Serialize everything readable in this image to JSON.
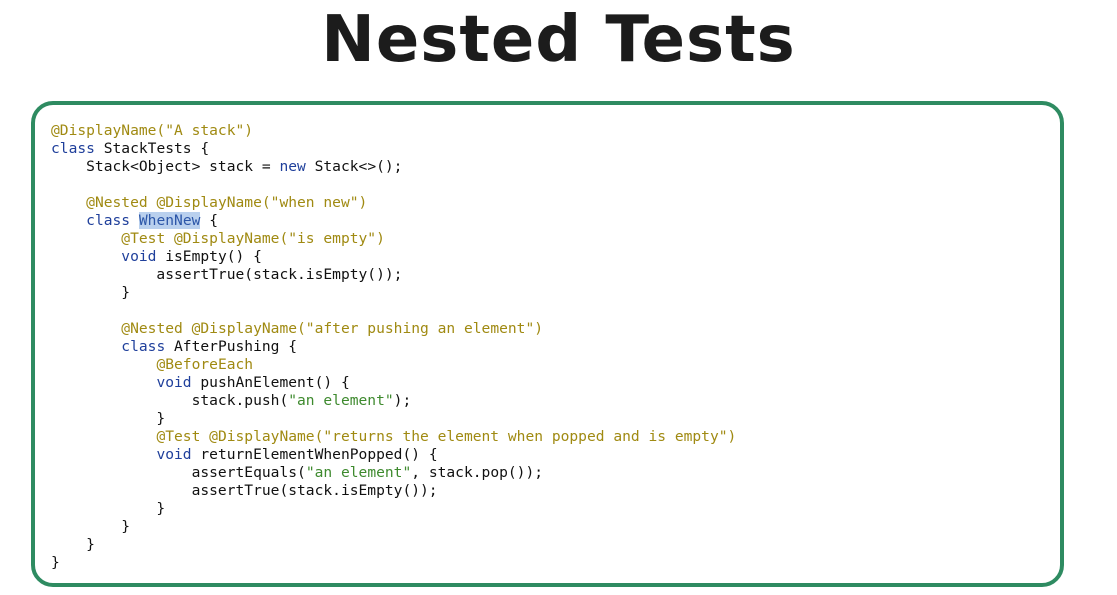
{
  "slide": {
    "title": "Nested Tests"
  },
  "code": {
    "lines": [
      [
        {
          "text": "@DisplayName(\"A stack\")",
          "kind": "annotation"
        }
      ],
      [
        {
          "text": "class",
          "kind": "keyword"
        },
        {
          "text": " StackTests {",
          "kind": "plain"
        }
      ],
      [
        {
          "text": "    Stack<Object> stack = ",
          "kind": "plain"
        },
        {
          "text": "new",
          "kind": "keyword"
        },
        {
          "text": " Stack<>();",
          "kind": "plain"
        }
      ],
      [],
      [
        {
          "text": "    ",
          "kind": "plain"
        },
        {
          "text": "@Nested @DisplayName(\"when new\")",
          "kind": "annotation"
        }
      ],
      [
        {
          "text": "    ",
          "kind": "plain"
        },
        {
          "text": "class",
          "kind": "keyword"
        },
        {
          "text": " ",
          "kind": "plain"
        },
        {
          "text": "WhenNew",
          "kind": "selected"
        },
        {
          "text": " {",
          "kind": "plain"
        }
      ],
      [
        {
          "text": "        ",
          "kind": "plain"
        },
        {
          "text": "@Test @DisplayName(\"is empty\")",
          "kind": "annotation"
        }
      ],
      [
        {
          "text": "        ",
          "kind": "plain"
        },
        {
          "text": "void",
          "kind": "keyword"
        },
        {
          "text": " isEmpty() {",
          "kind": "plain"
        }
      ],
      [
        {
          "text": "            assertTrue(stack.isEmpty());",
          "kind": "plain"
        }
      ],
      [
        {
          "text": "        }",
          "kind": "plain"
        }
      ],
      [],
      [
        {
          "text": "        ",
          "kind": "plain"
        },
        {
          "text": "@Nested @DisplayName(\"after pushing an element\")",
          "kind": "annotation"
        }
      ],
      [
        {
          "text": "        ",
          "kind": "plain"
        },
        {
          "text": "class",
          "kind": "keyword"
        },
        {
          "text": " AfterPushing {",
          "kind": "plain"
        }
      ],
      [
        {
          "text": "            ",
          "kind": "plain"
        },
        {
          "text": "@BeforeEach",
          "kind": "annotation"
        }
      ],
      [
        {
          "text": "            ",
          "kind": "plain"
        },
        {
          "text": "void",
          "kind": "keyword"
        },
        {
          "text": " pushAnElement() {",
          "kind": "plain"
        }
      ],
      [
        {
          "text": "                stack.push(",
          "kind": "plain"
        },
        {
          "text": "\"an element\"",
          "kind": "string"
        },
        {
          "text": ");",
          "kind": "plain"
        }
      ],
      [
        {
          "text": "            }",
          "kind": "plain"
        }
      ],
      [
        {
          "text": "            ",
          "kind": "plain"
        },
        {
          "text": "@Test @DisplayName(\"returns the element when popped and is empty\")",
          "kind": "annotation"
        }
      ],
      [
        {
          "text": "            ",
          "kind": "plain"
        },
        {
          "text": "void",
          "kind": "keyword"
        },
        {
          "text": " returnElementWhenPopped() {",
          "kind": "plain"
        }
      ],
      [
        {
          "text": "                assertEquals(",
          "kind": "plain"
        },
        {
          "text": "\"an element\"",
          "kind": "string"
        },
        {
          "text": ", stack.pop());",
          "kind": "plain"
        }
      ],
      [
        {
          "text": "                assertTrue(stack.isEmpty());",
          "kind": "plain"
        }
      ],
      [
        {
          "text": "            }",
          "kind": "plain"
        }
      ],
      [
        {
          "text": "        }",
          "kind": "plain"
        }
      ],
      [
        {
          "text": "    }",
          "kind": "plain"
        }
      ],
      [
        {
          "text": "}",
          "kind": "plain"
        }
      ]
    ]
  },
  "colors": {
    "card_border": "#2e8b61",
    "annotation": "#a08a12",
    "keyword": "#1f3f9b",
    "string": "#3e8a2e",
    "selection": "#b9d0ee"
  }
}
